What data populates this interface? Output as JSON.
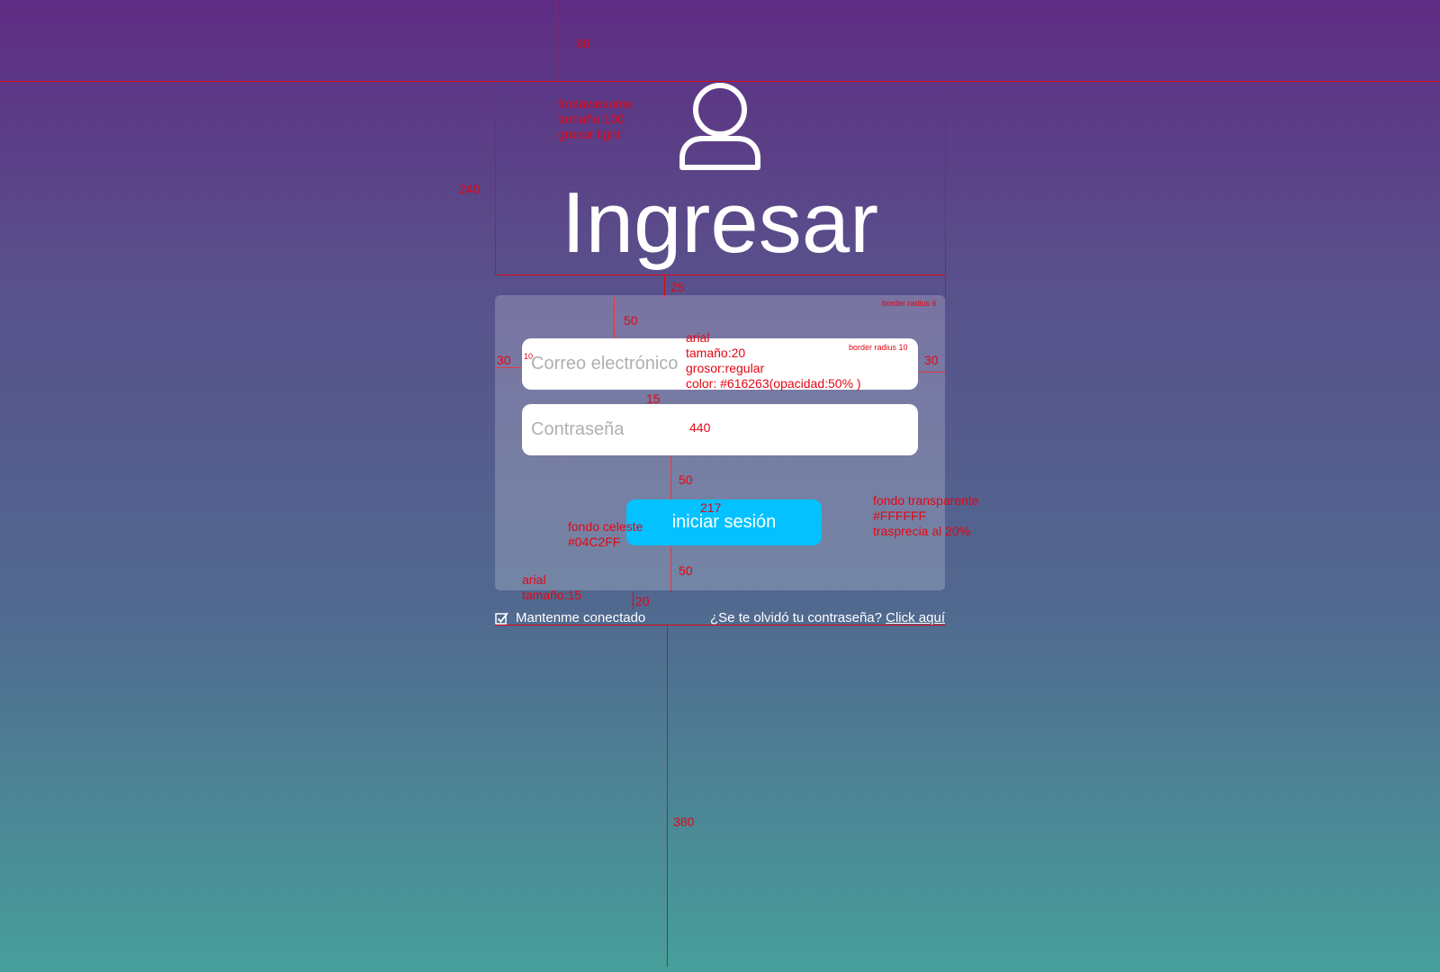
{
  "login": {
    "title": "Ingresar",
    "email_placeholder": "Correo electrónico",
    "password_placeholder": "Contraseña",
    "submit_label": "iniciar sesión",
    "remember_label": "Mantenme conectado",
    "forgot_text": "¿Se te olvidó tu contraseña? ",
    "forgot_link": "Click aquí "
  },
  "annotations": {
    "top_gap": "90",
    "icon_spec": "fontawesome\ntamaño:100\ngrosor:light",
    "header_height": "240",
    "gap_title_card": "25",
    "card_radius": "border radius 6",
    "card_top_pad": "50",
    "side_pad_left": "30",
    "side_pad_right": "30",
    "input_text_pad": "10",
    "input_font_spec": "arial\ntamaño:20\ngrosor:regular\ncolor: #616263(opacidad:50% )",
    "input_radius": "border radius 10",
    "input_gap": "15",
    "input_width": "440",
    "gap_before_button": "50",
    "button_width": "217",
    "button_bg_spec": "fondo celeste\n#04C2FF",
    "card_bg_spec": "fondo transparente\n#FFFFFF\ntrasprecia al 20%",
    "card_bottom_pad": "50",
    "footer_font_spec": "arial\ntamaño:15",
    "footer_gap": "20",
    "bottom_gap": "380"
  },
  "colors": {
    "button": "#04C2FF",
    "input_text": "#616263",
    "annotation": "#e30613",
    "card": "#FFFFFF"
  }
}
